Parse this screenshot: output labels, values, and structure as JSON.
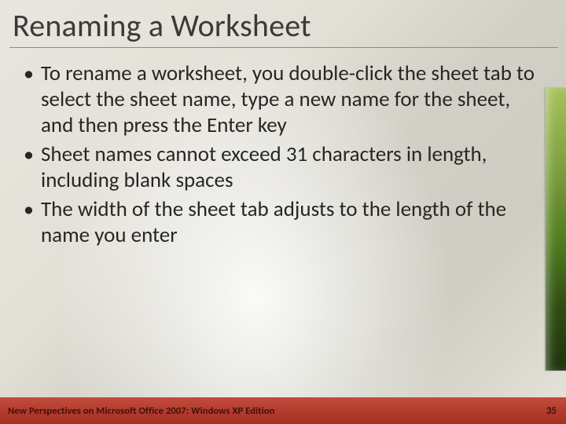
{
  "title": "Renaming a Worksheet",
  "bullets": [
    "To rename a worksheet, you double-click the sheet tab to select the sheet name, type a new name for the sheet, and then press the Enter key",
    "Sheet names cannot exceed 31 characters in length, including blank spaces",
    "The width of the sheet tab adjusts to the length of the name you enter"
  ],
  "footer": "New Perspectives on Microsoft Office 2007: Windows XP Edition",
  "page_number": "35"
}
